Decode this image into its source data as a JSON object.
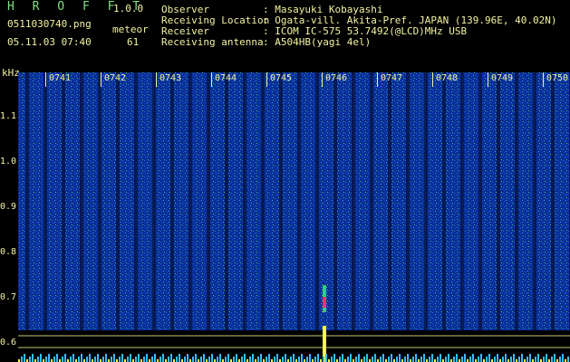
{
  "header": {
    "title": "H R O F F T",
    "version": "1.0.0",
    "file": "0511030740.png",
    "kind": "meteor",
    "datetime": "05.11.03 07:40",
    "count": "61",
    "meta": [
      {
        "key": "Observer",
        "value": ": Masayuki Kobayashi"
      },
      {
        "key": "Receiving Location",
        "value": ": Ogata-vill. Akita-Pref. JAPAN (139.96E, 40.02N)"
      },
      {
        "key": "Receiver",
        "value": ": ICOM IC-575 53.7492(@LCD)MHz USB"
      },
      {
        "key": "Receiving antenna",
        "value": ": A504HB(yagi 4el)"
      }
    ]
  },
  "axis": {
    "unit": "kHz",
    "ticks": [
      "1.1",
      "1.0",
      "0.9",
      "0.8",
      "0.7",
      "0.6"
    ]
  },
  "time_marks": [
    "0741",
    "0742",
    "0743",
    "0744",
    "0745",
    "0746",
    "0747",
    "0748",
    "0749",
    "0750"
  ],
  "colors": {
    "background": "#000000",
    "label": "#f2f2a0",
    "accent": "#7fe07f"
  }
}
